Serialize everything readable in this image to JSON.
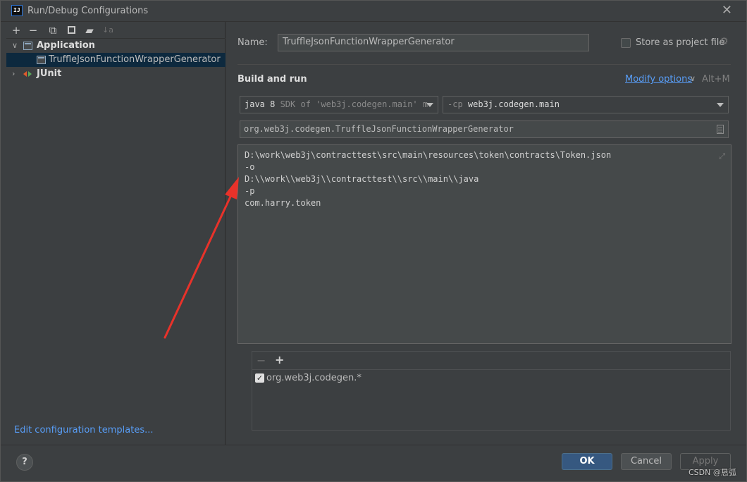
{
  "window": {
    "title": "Run/Debug Configurations",
    "app_icon_text": "IJ"
  },
  "toolbar": {
    "icons": [
      "add-icon",
      "remove-icon",
      "copy-icon",
      "save-icon",
      "new-folder-icon",
      "sort-icon"
    ],
    "add_symbol": "+",
    "remove_symbol": "−",
    "sort_symbol": "↓a"
  },
  "tree": {
    "application_label": "Application",
    "selected_config": "TruffleJsonFunctionWrapperGenerator",
    "junit_label": "JUnit"
  },
  "edit_templates_link": "Edit configuration templates...",
  "form": {
    "name_label": "Name:",
    "name_value": "TruffleJsonFunctionWrapperGenerator",
    "store_label": "Store as project file",
    "store_checked": false,
    "build_run_heading": "Build and run",
    "modify_options": "Modify options",
    "modify_shortcut": "Alt+M",
    "jre_main": "java 8",
    "jre_detail": " SDK of 'web3j.codegen.main' m",
    "cp_prefix": "-cp ",
    "cp_value": "web3j.codegen.main",
    "main_class": "org.web3j.codegen.TruffleJsonFunctionWrapperGenerator",
    "program_args": [
      "D:\\work\\web3j\\contracttest\\src\\main\\resources\\token\\contracts\\Token.json",
      "-o",
      "D:\\\\work\\\\web3j\\\\contracttest\\\\src\\\\main\\\\java",
      "-p",
      "com.harry.token"
    ]
  },
  "filters": {
    "remove_symbol": "−",
    "add_symbol": "+",
    "items": [
      {
        "label": "org.web3j.codegen.*",
        "checked": true
      }
    ]
  },
  "buttons": {
    "help": "?",
    "ok": "OK",
    "cancel": "Cancel",
    "apply": "Apply"
  },
  "watermark": "CSDN @恳弧",
  "annotation": {
    "arrow_color": "#e8322a"
  }
}
